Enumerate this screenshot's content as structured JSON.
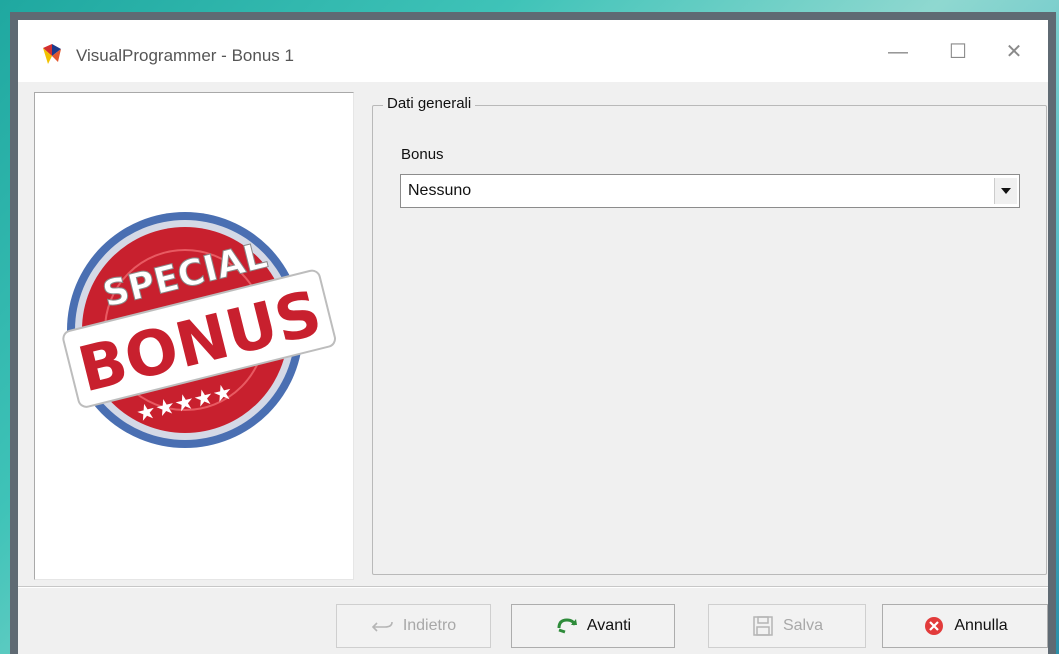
{
  "window": {
    "title": "VisualProgrammer - Bonus 1",
    "controls": {
      "minimize": "—",
      "maximize": "☐",
      "close": "✕"
    }
  },
  "image": {
    "line1": "SPECIAL",
    "line2": "BONUS",
    "stars": "★★★★★"
  },
  "group": {
    "legend": "Dati generali",
    "bonus_label": "Bonus",
    "bonus_value": "Nessuno"
  },
  "buttons": {
    "back": "Indietro",
    "next": "Avanti",
    "save": "Salva",
    "cancel": "Annulla"
  },
  "colors": {
    "accent_red": "#c8202e",
    "next_green": "#2e8b3a",
    "cancel_red": "#e23b3b"
  }
}
